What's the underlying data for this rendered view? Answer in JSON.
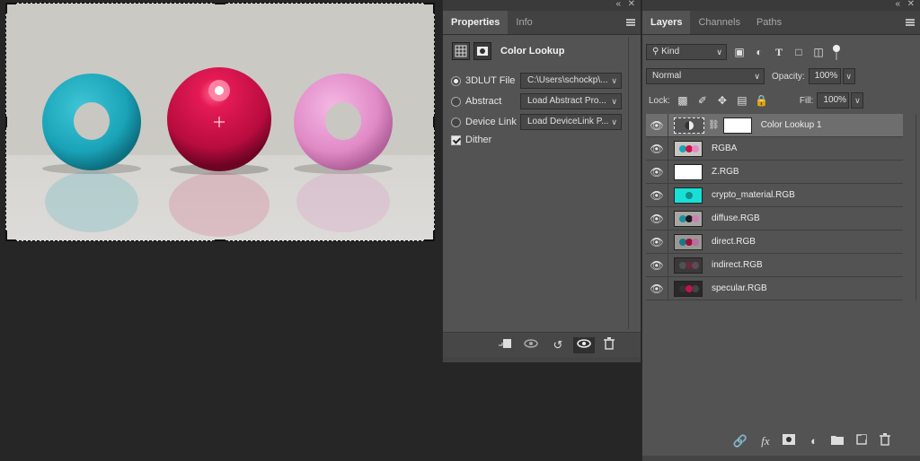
{
  "colors": {
    "teal": "#1aa3b8",
    "crimson": "#d0104a",
    "pink": "#e08ac6",
    "panel": "#535353",
    "cyan_thumb": "#19e0d6"
  },
  "properties": {
    "tabs": [
      {
        "label": "Properties",
        "active": true
      },
      {
        "label": "Info",
        "active": false
      }
    ],
    "title": "Color Lookup",
    "options": [
      {
        "label": "3DLUT File",
        "selected": true,
        "value": "C:\\Users\\schockp\\..."
      },
      {
        "label": "Abstract",
        "selected": false,
        "value": "Load Abstract Pro..."
      },
      {
        "label": "Device Link",
        "selected": false,
        "value": "Load DeviceLink P..."
      }
    ],
    "dither_label": "Dither",
    "dither_checked": true,
    "footer_icons": [
      "clip-to-layer-icon",
      "view-previous-state-icon",
      "reset-icon",
      "visibility-icon",
      "trash-icon"
    ]
  },
  "layers_panel": {
    "tabs": [
      {
        "label": "Layers",
        "active": true
      },
      {
        "label": "Channels",
        "active": false
      },
      {
        "label": "Paths",
        "active": false
      }
    ],
    "filter": "Kind",
    "blend_mode": "Normal",
    "opacity_label": "Opacity:",
    "opacity_value": "100%",
    "lock_label": "Lock:",
    "fill_label": "Fill:",
    "fill_value": "100%",
    "layers": [
      {
        "name": "Color Lookup 1",
        "selected": true,
        "thumb": "adjustment"
      },
      {
        "name": "RGBA",
        "selected": false,
        "thumb": "render"
      },
      {
        "name": "Z.RGB",
        "selected": false,
        "thumb": "white"
      },
      {
        "name": "crypto_material.RGB",
        "selected": false,
        "thumb": "cyan"
      },
      {
        "name": "diffuse.RGB",
        "selected": false,
        "thumb": "render"
      },
      {
        "name": "direct.RGB",
        "selected": false,
        "thumb": "render-dark"
      },
      {
        "name": "indirect.RGB",
        "selected": false,
        "thumb": "dark"
      },
      {
        "name": "specular.RGB",
        "selected": false,
        "thumb": "dark"
      }
    ],
    "footer_icons": [
      "link-layers-icon",
      "fx-icon",
      "add-mask-icon",
      "adjustment-layer-icon",
      "new-group-icon",
      "new-layer-icon",
      "trash-icon"
    ]
  }
}
